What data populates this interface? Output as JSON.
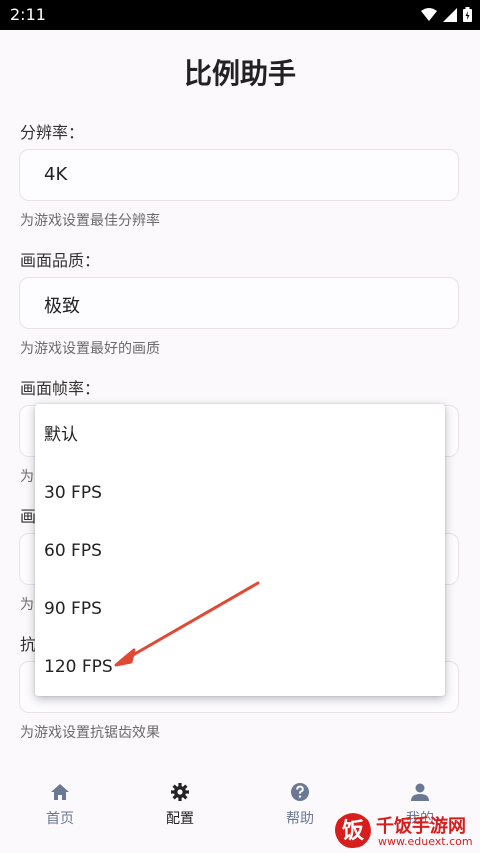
{
  "status_bar": {
    "time": "2:11"
  },
  "app_title": "比例助手",
  "fields": [
    {
      "label": "分辨率：",
      "value": "4K",
      "hint": "为游戏设置最佳分辨率"
    },
    {
      "label": "画面品质：",
      "value": "极致",
      "hint": "为游戏设置最好的画质"
    },
    {
      "label": "画面帧率：",
      "value": "",
      "hint": "为"
    },
    {
      "label": "画",
      "value": "",
      "hint": "为"
    },
    {
      "label": "抗",
      "value": "",
      "hint": "为游戏设置抗锯齿效果"
    }
  ],
  "fps_dropdown": {
    "options": [
      "默认",
      "30 FPS",
      "60 FPS",
      "90 FPS",
      "120 FPS"
    ],
    "highlighted": "120 FPS"
  },
  "bottom_nav": [
    {
      "label": "首页",
      "icon": "home-icon"
    },
    {
      "label": "配置",
      "icon": "gear-icon"
    },
    {
      "label": "帮助",
      "icon": "help-icon"
    },
    {
      "label": "我的",
      "icon": "person-icon"
    }
  ],
  "watermark": {
    "name": "千饭手游网",
    "url": "www.eduext.com"
  },
  "colors": {
    "accent_arrow": "#e04a35",
    "nav_muted": "#6b7893",
    "watermark": "#d81d1d"
  }
}
